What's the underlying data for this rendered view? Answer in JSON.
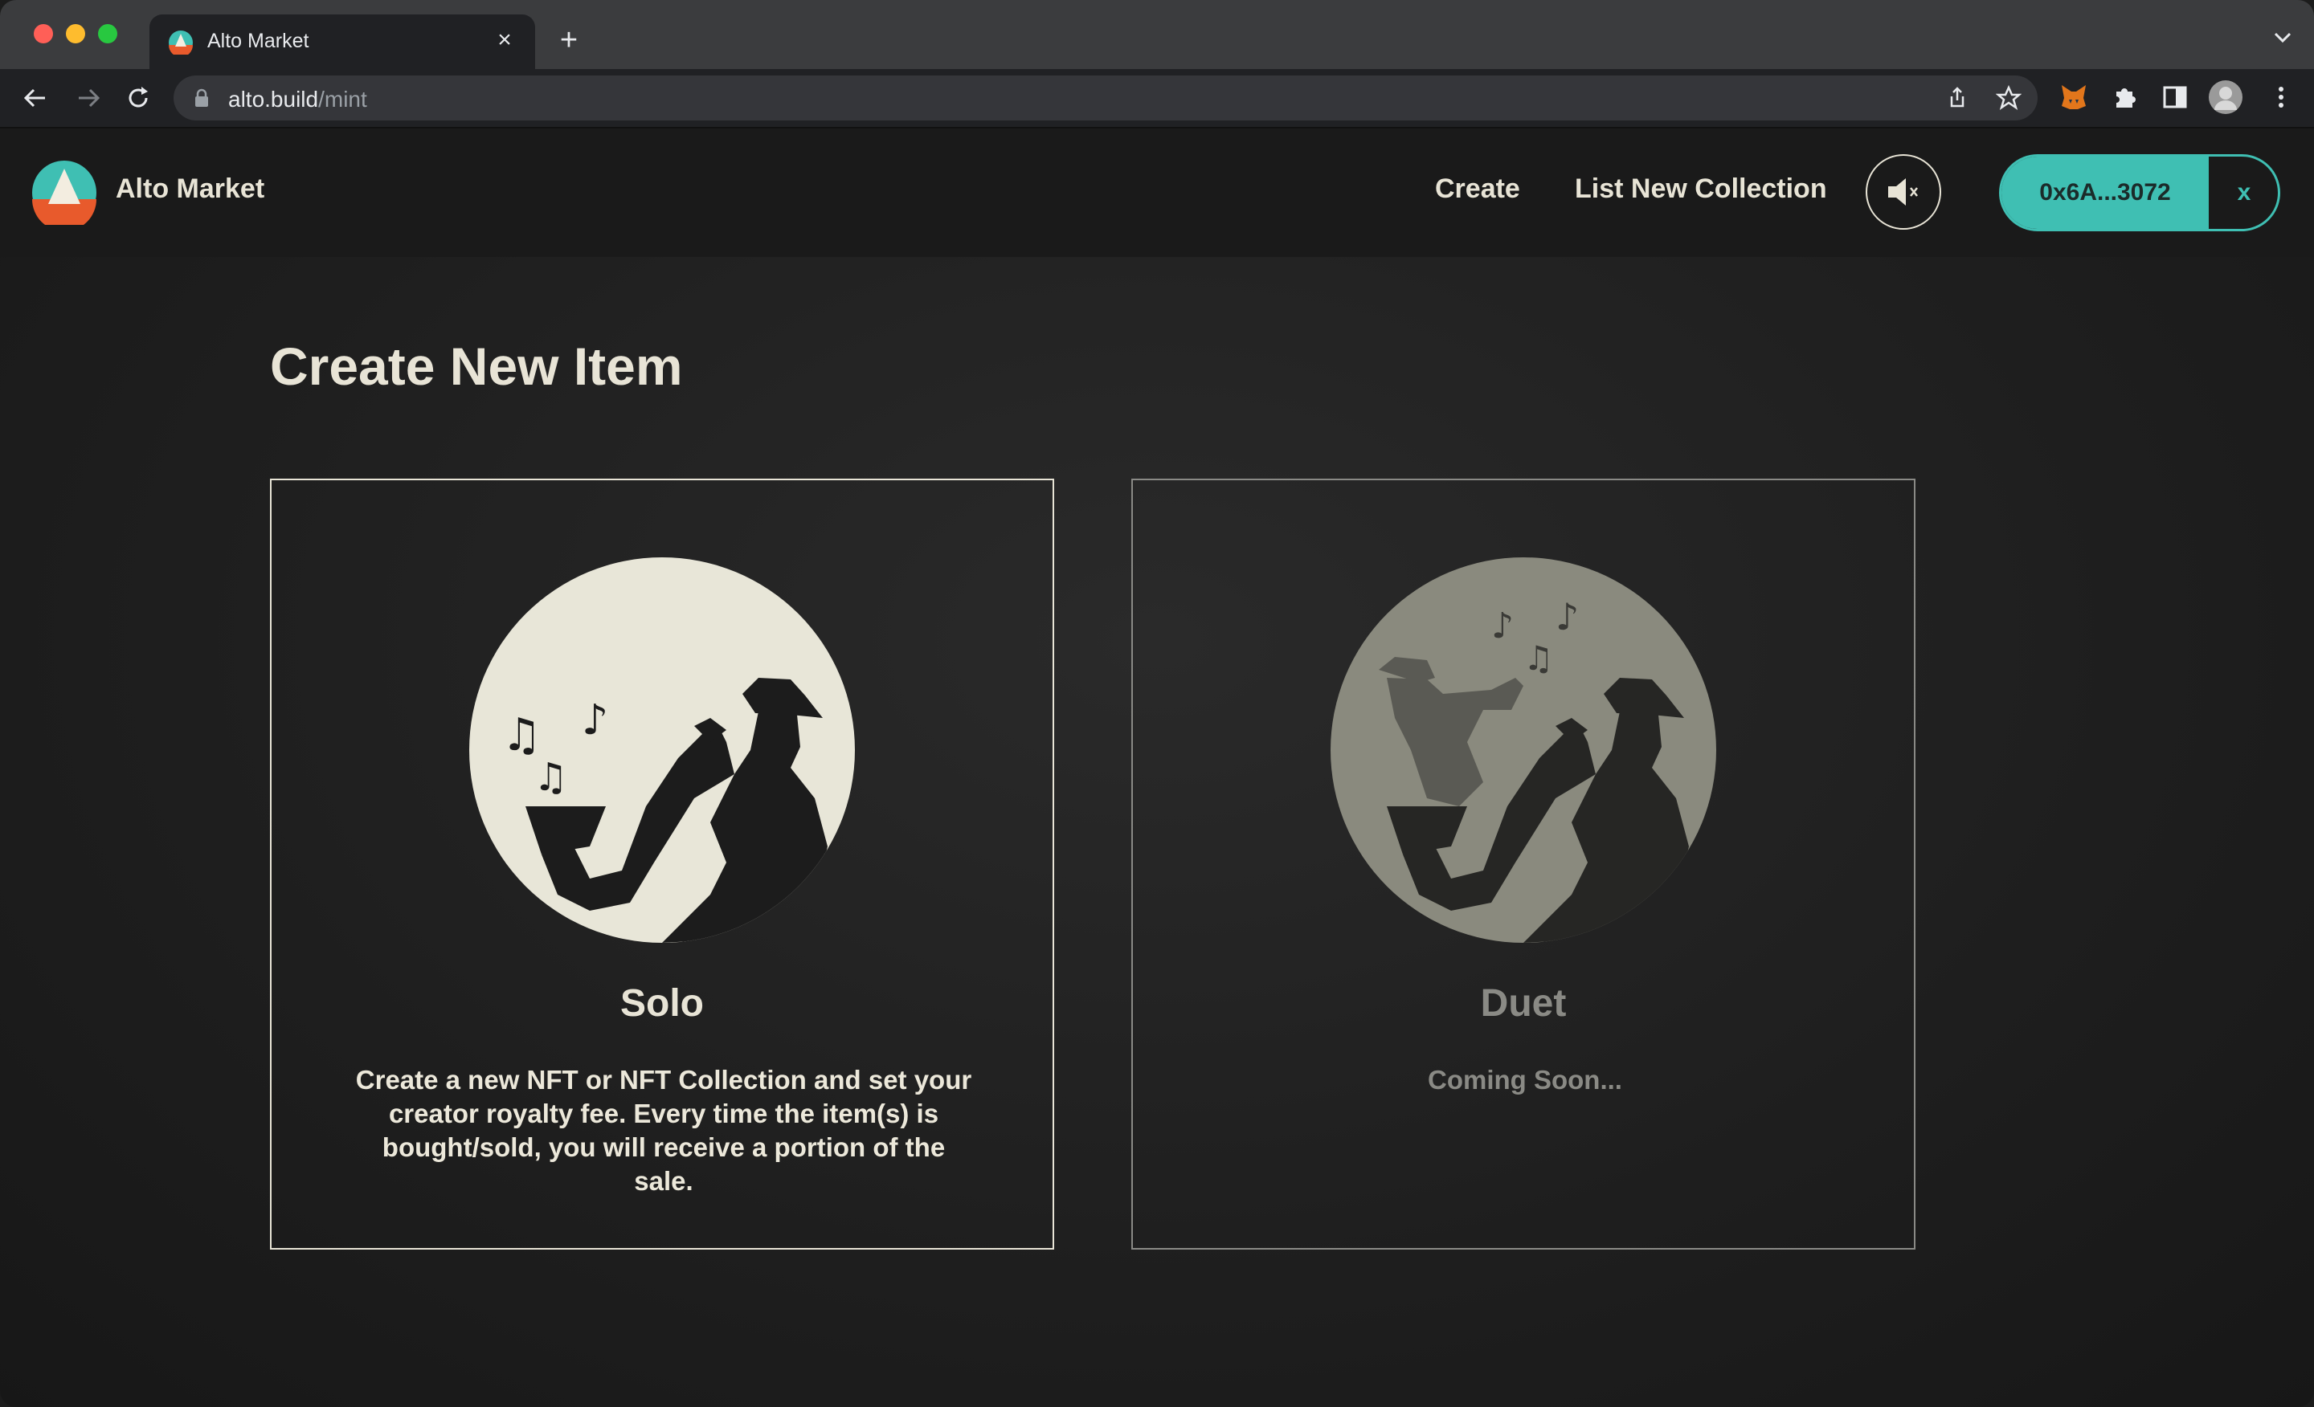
{
  "browser": {
    "tab_title": "Alto Market",
    "tab_close": "×",
    "new_tab": "+",
    "url_host": "alto.build",
    "url_path": "/mint"
  },
  "header": {
    "brand": "Alto Market",
    "nav": [
      {
        "label": "Create"
      },
      {
        "label": "List New Collection"
      }
    ],
    "wallet_address": "0x6A...3072",
    "wallet_disconnect": "x"
  },
  "main": {
    "title": "Create New Item",
    "cards": [
      {
        "title": "Solo",
        "description": "Create a new NFT or NFT Collection and set your creator royalty fee. Every time the item(s) is bought/sold, you will receive a portion of the sale."
      },
      {
        "title": "Duet",
        "description": "Coming Soon..."
      }
    ]
  },
  "colors": {
    "accent": "#3fbfb3",
    "text": "#e8e4d6",
    "background": "#1c1c1c"
  }
}
